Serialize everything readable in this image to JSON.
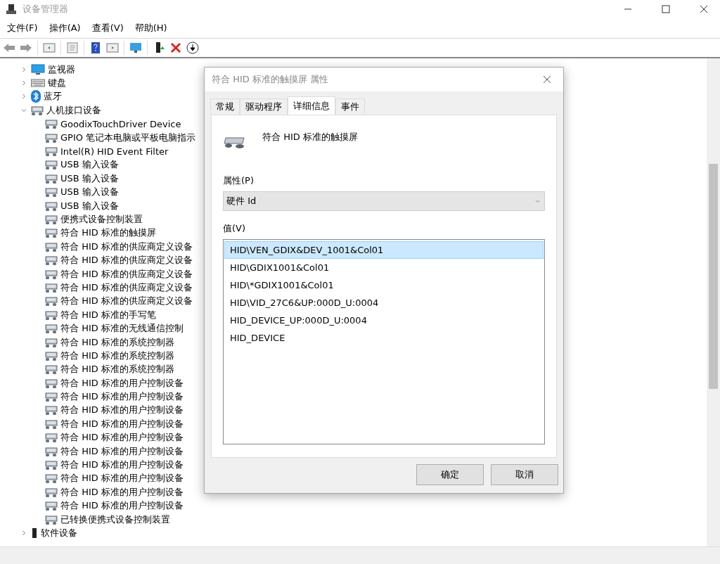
{
  "window": {
    "title": "设备管理器"
  },
  "menu": [
    "文件(F)",
    "操作(A)",
    "查看(V)",
    "帮助(H)"
  ],
  "tree": [
    {
      "label": "监视器",
      "kind": "monitor",
      "expanded": false
    },
    {
      "label": "键盘",
      "kind": "keyboard",
      "expanded": false
    },
    {
      "label": "蓝牙",
      "kind": "bluetooth",
      "expanded": false
    },
    {
      "label": "人机接口设备",
      "kind": "hid",
      "expanded": true,
      "children": [
        {
          "label": "GoodixTouchDriver Device"
        },
        {
          "label": "GPIO 笔记本电脑或平板电脑指示"
        },
        {
          "label": "Intel(R) HID Event Filter"
        },
        {
          "label": "USB 输入设备"
        },
        {
          "label": "USB 输入设备"
        },
        {
          "label": "USB 输入设备"
        },
        {
          "label": "USB 输入设备"
        },
        {
          "label": "便携式设备控制装置"
        },
        {
          "label": "符合 HID 标准的触摸屏"
        },
        {
          "label": "符合 HID 标准的供应商定义设备"
        },
        {
          "label": "符合 HID 标准的供应商定义设备"
        },
        {
          "label": "符合 HID 标准的供应商定义设备"
        },
        {
          "label": "符合 HID 标准的供应商定义设备"
        },
        {
          "label": "符合 HID 标准的供应商定义设备"
        },
        {
          "label": "符合 HID 标准的手写笔"
        },
        {
          "label": "符合 HID 标准的无线通信控制"
        },
        {
          "label": "符合 HID 标准的系统控制器"
        },
        {
          "label": "符合 HID 标准的系统控制器"
        },
        {
          "label": "符合 HID 标准的系统控制器"
        },
        {
          "label": "符合 HID 标准的用户控制设备"
        },
        {
          "label": "符合 HID 标准的用户控制设备"
        },
        {
          "label": "符合 HID 标准的用户控制设备"
        },
        {
          "label": "符合 HID 标准的用户控制设备"
        },
        {
          "label": "符合 HID 标准的用户控制设备"
        },
        {
          "label": "符合 HID 标准的用户控制设备"
        },
        {
          "label": "符合 HID 标准的用户控制设备"
        },
        {
          "label": "符合 HID 标准的用户控制设备"
        },
        {
          "label": "符合 HID 标准的用户控制设备"
        },
        {
          "label": "符合 HID 标准的用户控制设备"
        },
        {
          "label": "已转换便携式设备控制装置"
        }
      ]
    },
    {
      "label": "软件设备",
      "kind": "software",
      "expanded": false
    }
  ],
  "dialog": {
    "title": "符合 HID 标准的触摸屏 属性",
    "tabs": [
      {
        "label": "常规",
        "selected": false
      },
      {
        "label": "驱动程序",
        "selected": false
      },
      {
        "label": "详细信息",
        "selected": true
      },
      {
        "label": "事件",
        "selected": false
      }
    ],
    "device_name": "符合 HID 标准的触摸屏",
    "property_label": "属性(P)",
    "property_value": "硬件 Id",
    "value_label": "值(V)",
    "values": [
      {
        "text": "HID\\VEN_GDIX&DEV_1001&Col01",
        "selected": true
      },
      {
        "text": "HID\\GDIX1001&Col01",
        "selected": false
      },
      {
        "text": "HID\\*GDIX1001&Col01",
        "selected": false
      },
      {
        "text": "HID\\VID_27C6&UP:000D_U:0004",
        "selected": false
      },
      {
        "text": "HID_DEVICE_UP:000D_U:0004",
        "selected": false
      },
      {
        "text": "HID_DEVICE",
        "selected": false
      }
    ],
    "buttons": [
      "确定",
      "取消"
    ]
  }
}
